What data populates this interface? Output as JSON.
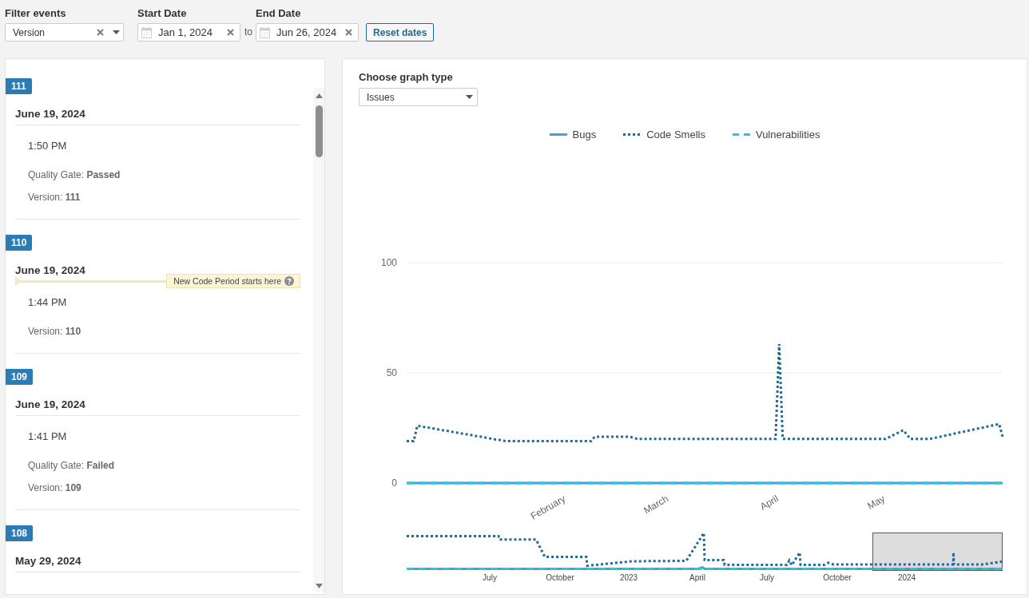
{
  "filters": {
    "event_filter": {
      "label": "Filter events",
      "value": "Version"
    },
    "start_date": {
      "label": "Start Date",
      "value": "Jan 1, 2024"
    },
    "separator": "to",
    "end_date": {
      "label": "End Date",
      "value": "Jun 26, 2024"
    },
    "reset_button": "Reset dates"
  },
  "events": [
    {
      "badge": "111",
      "date": "June 19, 2024",
      "time": "1:50 PM",
      "details": [
        "Quality Gate: **Passed**",
        "Version: **111**"
      ]
    },
    {
      "badge": "110",
      "date": "June 19, 2024",
      "new_code_period": "New Code Period starts here",
      "time": "1:44 PM",
      "details": [
        "Version: **110**"
      ]
    },
    {
      "badge": "109",
      "date": "June 19, 2024",
      "time": "1:41 PM",
      "details": [
        "Quality Gate: **Failed**",
        "Version: **109**"
      ]
    },
    {
      "badge": "108",
      "date": "May 29, 2024"
    }
  ],
  "graph": {
    "type_label": "Choose graph type",
    "type_value": "Issues",
    "chart_data": {
      "type": "line",
      "categories": [
        null,
        null,
        null,
        null,
        null,
        null,
        null,
        null,
        null,
        null,
        null,
        null,
        null,
        null,
        null,
        null,
        null,
        null,
        null,
        null,
        null,
        null,
        null,
        null,
        null,
        null,
        null,
        null,
        null,
        null,
        null,
        null,
        null,
        null,
        null,
        null,
        null,
        null,
        null,
        null,
        null,
        null,
        null,
        null,
        null,
        "February",
        null,
        null,
        null,
        null,
        null,
        null,
        null,
        null,
        null,
        null,
        null,
        null,
        null,
        null,
        null,
        null,
        null,
        null,
        null,
        null,
        null,
        null,
        null,
        null,
        null,
        null,
        null,
        null,
        "March",
        null,
        null,
        null,
        null,
        null,
        null,
        null,
        null,
        null,
        null,
        null,
        null,
        null,
        null,
        null,
        null,
        null,
        null,
        null,
        null,
        null,
        null,
        null,
        null,
        null,
        null,
        null,
        null,
        null,
        null,
        "April",
        null,
        null,
        null,
        null,
        null,
        null,
        null,
        null,
        null,
        null,
        null,
        null,
        null,
        null,
        null,
        null,
        null,
        null,
        null,
        null,
        null,
        null,
        null,
        null,
        null,
        null,
        null,
        null,
        null,
        "May",
        null,
        null,
        null,
        null,
        null,
        null,
        null,
        null,
        null,
        null,
        null,
        null,
        null,
        null,
        null,
        null,
        null,
        null,
        null,
        null,
        null,
        null,
        null,
        null,
        null,
        null,
        null,
        null,
        null,
        null,
        null,
        null,
        null
      ],
      "ylim": [
        0,
        100
      ],
      "yticks": [
        0,
        50,
        100
      ],
      "series": [
        {
          "name": "Bugs",
          "color": "#4b9fd5",
          "line_style": "solid",
          "values": [
            0,
            0,
            0,
            0,
            0,
            0,
            0,
            0,
            0,
            0,
            0,
            0,
            0,
            0,
            0,
            0,
            0,
            0,
            0,
            0,
            0,
            0,
            0,
            0,
            0,
            0,
            0,
            0,
            0,
            0,
            0,
            0,
            0,
            0,
            0,
            0,
            0,
            0,
            0,
            0,
            0,
            0,
            0,
            0,
            0,
            0,
            0,
            0,
            0,
            0,
            0,
            0,
            0,
            0,
            0,
            0,
            0,
            0,
            0,
            0,
            0,
            0,
            0,
            0,
            0,
            0,
            0,
            0,
            0,
            0,
            0,
            0,
            0,
            0,
            0,
            0,
            0,
            0,
            0,
            0,
            0,
            0,
            0,
            0,
            0,
            0,
            0,
            0,
            0,
            0,
            0,
            0,
            0,
            0,
            0,
            0,
            0,
            0,
            0,
            0,
            0,
            0,
            0,
            0,
            0,
            0,
            0,
            0,
            0,
            0,
            0,
            0,
            0,
            0,
            0,
            0,
            0,
            0,
            0,
            0,
            0,
            0,
            0,
            0,
            0,
            0,
            0,
            0,
            0,
            0,
            0,
            0,
            0,
            0,
            0,
            0,
            0,
            0,
            0,
            0,
            0,
            0,
            0,
            0,
            0,
            0,
            0,
            0,
            0,
            0,
            0,
            0,
            0,
            0,
            0,
            0,
            0,
            0,
            0,
            0,
            0,
            0,
            0,
            0,
            0,
            0,
            0,
            0,
            0
          ]
        },
        {
          "name": "Code Smells",
          "color": "#236a97",
          "line_style": "dotted",
          "values": [
            19,
            19,
            19,
            26,
            25.7,
            25.4,
            25.2,
            24.9,
            24.6,
            24.3,
            24,
            23.8,
            23.5,
            23.2,
            22.9,
            22.6,
            22.4,
            22.1,
            21.8,
            21.5,
            21.2,
            21,
            20.7,
            20.4,
            20.1,
            19.8,
            19.6,
            19.3,
            19,
            19,
            19,
            19,
            19,
            19,
            19,
            19,
            19,
            19,
            19,
            19,
            19,
            19,
            19,
            19,
            19,
            19,
            19,
            19,
            19,
            19,
            19,
            19,
            19,
            21,
            21,
            21,
            21,
            21,
            21,
            21,
            21,
            21,
            21,
            21,
            20.5,
            20,
            20,
            20,
            20,
            20,
            20,
            20,
            20,
            20,
            20,
            20,
            20,
            20,
            20,
            20,
            20,
            20,
            20,
            20,
            20,
            20,
            20,
            20,
            20,
            20,
            20,
            20,
            20,
            20,
            20,
            20,
            20,
            20,
            20,
            20,
            20,
            20,
            20,
            20,
            20,
            63,
            20,
            20,
            20,
            20,
            20,
            20,
            20,
            20,
            20,
            20,
            20,
            20,
            20,
            20,
            20,
            20,
            20,
            20,
            20,
            20,
            20,
            20,
            20,
            20,
            20,
            20,
            20,
            20,
            20,
            20,
            20.8,
            21.6,
            22.4,
            23.2,
            24,
            22,
            20,
            20,
            20,
            20,
            20,
            20,
            20.2,
            20.5,
            20.9,
            21.2,
            21.6,
            21.9,
            22.3,
            22.6,
            23,
            23.3,
            23.7,
            24,
            24.4,
            24.7,
            25,
            25.4,
            25.7,
            26.1,
            26.4,
            26.8,
            21
          ]
        },
        {
          "name": "Vulnerabilities",
          "color": "#24c6e0",
          "line_style": "dashed",
          "values": [
            0,
            0,
            0,
            0,
            0,
            0,
            0,
            0,
            0,
            0,
            0,
            0,
            0,
            0,
            0,
            0,
            0,
            0,
            0,
            0,
            0,
            0,
            0,
            0,
            0,
            0,
            0,
            0,
            0,
            0,
            0,
            0,
            0,
            0,
            0,
            0,
            0,
            0,
            0,
            0,
            0,
            0,
            0,
            0,
            0,
            0,
            0,
            0,
            0,
            0,
            0,
            0,
            0,
            0,
            0,
            0,
            0,
            0,
            0,
            0,
            0,
            0,
            0,
            0,
            0,
            0,
            0,
            0,
            0,
            0,
            0,
            0,
            0,
            0,
            0,
            0,
            0,
            0,
            0,
            0,
            0,
            0,
            0,
            0,
            0,
            0,
            0,
            0,
            0,
            0,
            0,
            0,
            0,
            0,
            0,
            0,
            0,
            0,
            0,
            0,
            0,
            0,
            0,
            0,
            0,
            0,
            0,
            0,
            0,
            0,
            0,
            0,
            0,
            0,
            0,
            0,
            0,
            0,
            0,
            0,
            0,
            0,
            0,
            0,
            0,
            0,
            0,
            0,
            0,
            0,
            0,
            0,
            0,
            0,
            0,
            0,
            0,
            0,
            0,
            0,
            0,
            0,
            0,
            0,
            0,
            0,
            0,
            0,
            0,
            0,
            0,
            0,
            0,
            0,
            0,
            0,
            0,
            0,
            0,
            0,
            0,
            0,
            0,
            0,
            0,
            0,
            0,
            0,
            0
          ]
        }
      ]
    },
    "overview": {
      "axis_labels": [
        "July",
        "October",
        "2023",
        "April",
        "July",
        "October",
        "2024"
      ]
    }
  }
}
